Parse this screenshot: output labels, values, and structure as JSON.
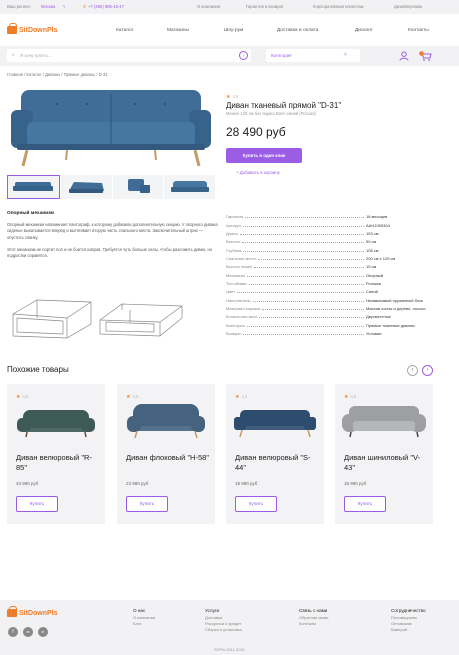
{
  "topbar": {
    "region_label": "Ваш регион:",
    "region_value": "Москва",
    "phone": "+7 (495) 985-15-47",
    "links": [
      "О компании",
      "Гарантия и возврат",
      "Корпоративным клиентам",
      "Дизайнерским"
    ]
  },
  "header": {
    "logo": "SitDownPls",
    "nav": [
      "Каталог",
      "Магазины",
      "Шоу-рум",
      "Доставка и оплата",
      "Дисконт",
      "Контакты"
    ]
  },
  "search": {
    "placeholder": "Я хочу купить...",
    "category": "Категория"
  },
  "breadcrumb": "Главная / Каталог / Диваны / Прямые диваны / D-31",
  "product": {
    "rating": "4,8",
    "title": "Диван тканевый прямой \"D-31\"",
    "subtitle": "Можно 120 см без ящика Bonn синий (Россия)",
    "price": "28 490 руб",
    "buy_one_click": "Купить в один клик",
    "add_to_cart": "+ Добавить в корзину"
  },
  "description": {
    "heading": "Опорный механизм",
    "paragraphs": [
      "Опорный механизм напоминает пантограф, к которому добавили дополнительную секцию. У опорного дивана сиденье выкатывается вперёд и вытягивает вторую часть спального места. Заключительный штрих — опустить спинку.",
      "Этот механизм не портит пол и не боится ковров. Требуется чуть больше силы, чтобы разложить диван, но подростки справятся."
    ]
  },
  "specs": [
    {
      "k": "Гарантия",
      "v": "18 месяцев"
    },
    {
      "k": "Артикул",
      "v": "AAH1059304"
    },
    {
      "k": "Длина",
      "v": "153 см"
    },
    {
      "k": "Высота",
      "v": "90 см"
    },
    {
      "k": "Глубина",
      "v": "108 см"
    },
    {
      "k": "Спальное место",
      "v": "200 см х 125 см"
    },
    {
      "k": "Высота ножек",
      "v": "15 см"
    },
    {
      "k": "Механизм",
      "v": "Опорный"
    },
    {
      "k": "Тип обивки",
      "v": "Рогожка"
    },
    {
      "k": "Цвет",
      "v": "Синий"
    },
    {
      "k": "Наполнитель",
      "v": "Независимый пружинный блок"
    },
    {
      "k": "Материал каркаса",
      "v": "Массив сосны и дерево, лососи"
    },
    {
      "k": "Количество мест",
      "v": "Двухместные"
    },
    {
      "k": "Категория",
      "v": "Прямые тканевые диваны"
    },
    {
      "k": "Возврат",
      "v": "Условия"
    }
  ],
  "similar": {
    "heading": "Похожие товары",
    "prev_icon": "‹",
    "next_icon": "›",
    "items": [
      {
        "rating": "4,5",
        "name": "Диван велюровый \"R-85\"",
        "price": "34 990 руб",
        "buy": "Купить",
        "color": "#3d5a56"
      },
      {
        "rating": "4,6",
        "name": "Диван флоковый \"H-58\"",
        "price": "23 990 руб",
        "buy": "Купить",
        "color": "#45637e"
      },
      {
        "rating": "4,3",
        "name": "Диван велюровый \"S-44\"",
        "price": "19 990 руб",
        "buy": "Купить",
        "color": "#2e4d6e"
      },
      {
        "rating": "4,8",
        "name": "Диван шиниловый \"V-43\"",
        "price": "19 990 руб",
        "buy": "Купить",
        "color": "#9d9fa1"
      }
    ]
  },
  "footer": {
    "logo": "SitDownPls",
    "columns": [
      {
        "title": "О нас",
        "items": [
          "О компании",
          "Блог"
        ]
      },
      {
        "title": "Услуги",
        "items": [
          "Доставка",
          "Рассрочка и кредит",
          "Сборка и установка"
        ]
      },
      {
        "title": "Связь с нами",
        "items": [
          "Обратная связь",
          "Контакты"
        ]
      },
      {
        "title": "Сотрудничество",
        "items": [
          "Поставщикам",
          "Оптовикам",
          "Камерой"
        ]
      }
    ],
    "social": [
      "f",
      "vk",
      "in"
    ],
    "copyright": "SDPls  2011-2021"
  },
  "colors": {
    "accent": "#9b5de5",
    "brand": "#f07c27",
    "sofa": "#3f6d97"
  }
}
